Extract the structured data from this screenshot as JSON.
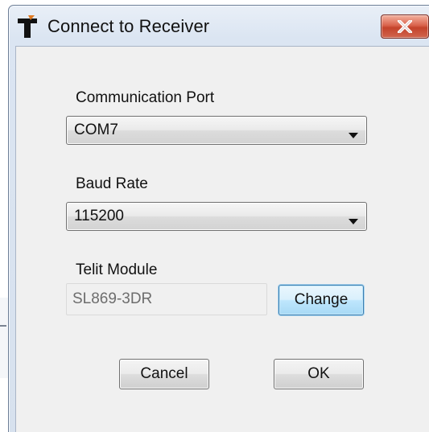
{
  "window": {
    "title": "Connect to Receiver",
    "app_icon": "telit-t-icon",
    "close_icon": "close-x-icon"
  },
  "port": {
    "label": "Communication Port",
    "selected": "COM7"
  },
  "baud": {
    "label": "Baud Rate",
    "selected": "115200"
  },
  "module": {
    "label": "Telit Module",
    "value": "SL869-3DR",
    "change_label": "Change"
  },
  "footer": {
    "cancel_label": "Cancel",
    "ok_label": "OK"
  },
  "colors": {
    "close_button": "#c4432b",
    "focused_button_border": "#3c7fb1",
    "dialog_frame": "#dbe5f2",
    "client_bg": "#f0f0f0"
  }
}
